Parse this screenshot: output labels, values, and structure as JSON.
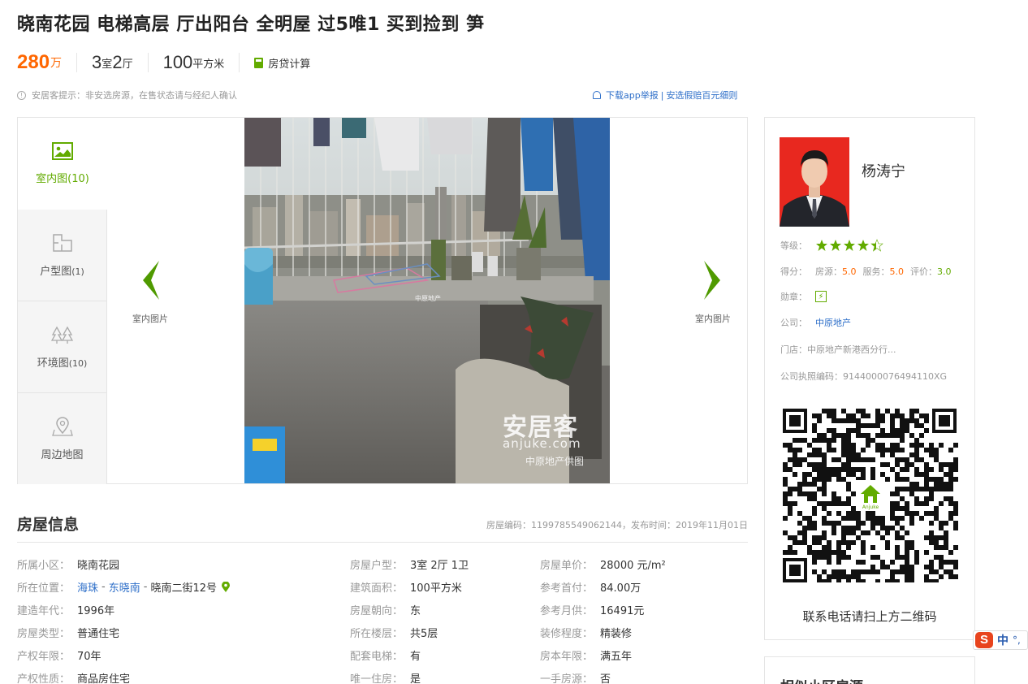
{
  "title": "晓南花园 电梯高层 厅出阳台 全明屋 过5唯1 买到捡到 笋",
  "summary": {
    "price": "280",
    "price_unit": "万",
    "room_num": "3",
    "room_unit": "室",
    "hall_num": "2",
    "hall_unit": "厅",
    "area_num": "100",
    "area_unit": "平方米",
    "calc_label": "房贷计算"
  },
  "notice": "安居客提示：非安选房源，在售状态请与经纪人确认",
  "report": {
    "download": "下载app举报",
    "divider": "|",
    "guarantee": "安选假赔百元细则"
  },
  "gallery": {
    "tabs": [
      {
        "label": "室内图",
        "count": "(10)",
        "icon": "image-icon"
      },
      {
        "label": "户型图",
        "count": "(1)",
        "icon": "floorplan-icon"
      },
      {
        "label": "环境图",
        "count": "(10)",
        "icon": "trees-icon"
      },
      {
        "label": "周边地图",
        "count": "",
        "icon": "map-pin-icon"
      }
    ],
    "prev_label": "室内图片",
    "next_label": "室内图片",
    "watermark_brand": "安居客",
    "watermark_url": "anjuke.com",
    "watermark_supplier": "中原地产供图",
    "photo_stamp": "中原地产"
  },
  "house_info": {
    "title": "房屋信息",
    "code_label": "房屋编码：",
    "code": "1199785549062144",
    "publish_label": "，发布时间：",
    "publish": "2019年11月01日",
    "col1": [
      {
        "k": "所属小区：",
        "v": "晓南花园"
      },
      {
        "k": "所在位置：",
        "v": ""
      },
      {
        "k": "建造年代：",
        "v": "1996年"
      },
      {
        "k": "房屋类型：",
        "v": "普通住宅"
      },
      {
        "k": "产权年限：",
        "v": "70年"
      },
      {
        "k": "产权性质：",
        "v": "商品房住宅"
      }
    ],
    "location": {
      "district": "海珠",
      "area": "东晓南",
      "street": "晓南二街12号",
      "dash": "-"
    },
    "col2": [
      {
        "k": "房屋户型：",
        "v": "3室 2厅 1卫"
      },
      {
        "k": "建筑面积：",
        "v": "100平方米"
      },
      {
        "k": "房屋朝向：",
        "v": "东"
      },
      {
        "k": "所在楼层：",
        "v": "共5层"
      },
      {
        "k": "配套电梯：",
        "v": "有"
      },
      {
        "k": "唯一住房：",
        "v": "是"
      }
    ],
    "col3": [
      {
        "k": "房屋单价：",
        "v": "28000 元/m²"
      },
      {
        "k": "参考首付：",
        "v": "84.00万"
      },
      {
        "k": "参考月供：",
        "v": "16491元"
      },
      {
        "k": "装修程度：",
        "v": "精装修"
      },
      {
        "k": "房本年限：",
        "v": "满五年"
      },
      {
        "k": "一手房源：",
        "v": "否"
      }
    ]
  },
  "agent": {
    "name": "杨涛宁",
    "level_label": "等级：",
    "level_stars": 4.5,
    "score_label": "得分：",
    "src_label": "房源：",
    "src_score": "5.0",
    "svc_label": "服务：",
    "svc_score": "5.0",
    "eval_label": "评价：",
    "eval_score": "3.0",
    "medal_label": "勋章：",
    "company_label": "公司：",
    "company": "中原地产",
    "store_label": "门店：",
    "store": "中原地产新港西分行...",
    "license_label": "公司执照编码：",
    "license": "9144000076494110XG",
    "qr_logo_text": "Anjuke",
    "qr_hint": "联系电话请扫上方二维码",
    "colors": {
      "accent_green": "#62ab00",
      "score_orange": "#ff6600",
      "avatar_bg": "#e8281f"
    }
  },
  "similar": {
    "title": "相似小区房源"
  },
  "ime": {
    "logo": "S",
    "mode": "中",
    "punct": "°,"
  }
}
